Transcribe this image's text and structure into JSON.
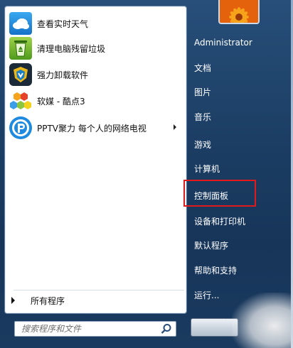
{
  "programs": [
    {
      "label": "查看实时天气",
      "icon": "weather-cloud-icon"
    },
    {
      "label": "清理电脑残留垃圾",
      "icon": "recycle-bin-icon"
    },
    {
      "label": "强力卸载软件",
      "icon": "uninstaller-shield-icon"
    },
    {
      "label": "软媒 - 酷点3",
      "icon": "honeycomb-icon"
    },
    {
      "label": "PPTV聚力 每个人的网络电视",
      "icon": "pptv-icon",
      "has_submenu": true
    }
  ],
  "all_programs": "所有程序",
  "search": {
    "placeholder": "搜索程序和文件"
  },
  "right_items": [
    "Administrator",
    "文档",
    "图片",
    "音乐",
    "游戏",
    "计算机",
    "控制面板",
    "设备和打印机",
    "默认程序",
    "帮助和支持",
    "运行..."
  ],
  "colors": {
    "highlight": "#e0191b",
    "pane_bg": "#ffffff",
    "menu_bg": "#1c3e64"
  }
}
